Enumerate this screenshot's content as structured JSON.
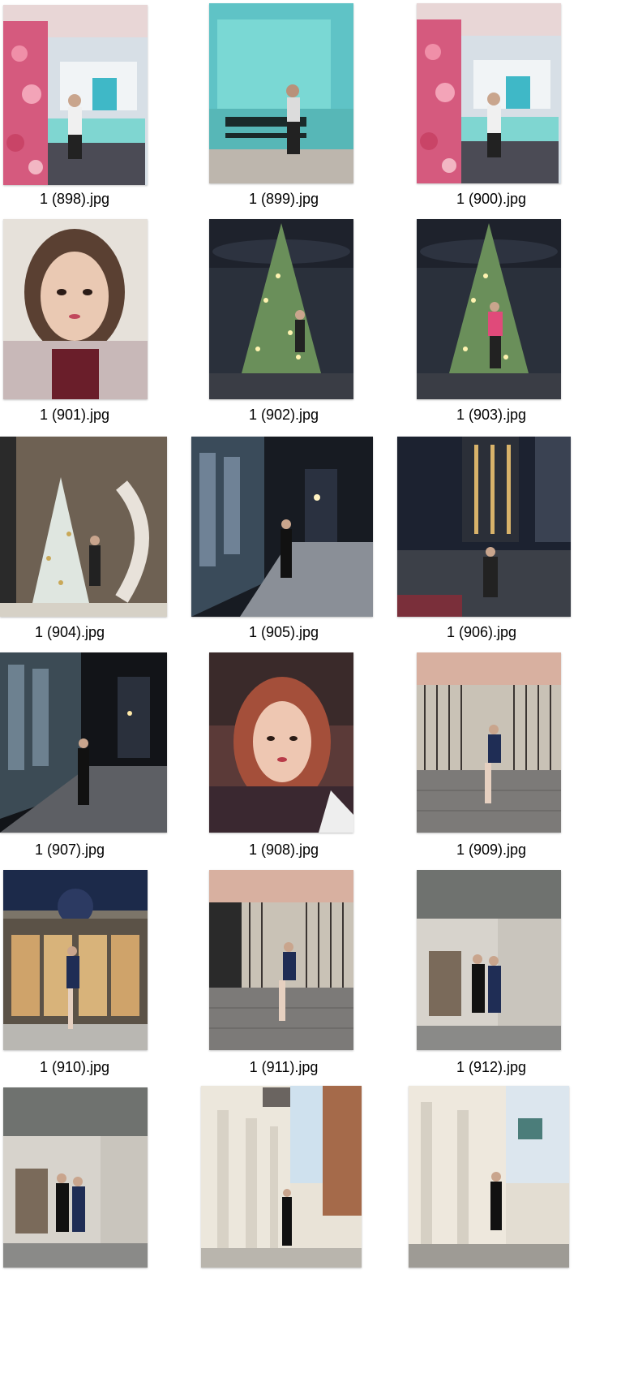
{
  "files": [
    {
      "name": "1 (898).jpg",
      "image": "tiffany-rose-booth-photo"
    },
    {
      "name": "1 (899).jpg",
      "image": "tiffany-blue-bench-photo"
    },
    {
      "name": "1 (900).jpg",
      "image": "tiffany-rose-booth-photo"
    },
    {
      "name": "1 (901).jpg",
      "image": "selfie-tweed-jacket-photo"
    },
    {
      "name": "1 (902).jpg",
      "image": "christmas-tree-lobby-photo"
    },
    {
      "name": "1 (903).jpg",
      "image": "christmas-tree-lobby-photo"
    },
    {
      "name": "1 (904).jpg",
      "image": "christmas-tree-staircase-photo"
    },
    {
      "name": "1 (905).jpg",
      "image": "night-street-photo"
    },
    {
      "name": "1 (906).jpg",
      "image": "night-street-photo"
    },
    {
      "name": "1 (907).jpg",
      "image": "night-street-photo"
    },
    {
      "name": "1 (908).jpg",
      "image": "car-selfie-photo"
    },
    {
      "name": "1 (909).jpg",
      "image": "iron-gate-steps-photo"
    },
    {
      "name": "1 (910).jpg",
      "image": "building-entrance-photo"
    },
    {
      "name": "1 (911).jpg",
      "image": "iron-gate-steps-photo"
    },
    {
      "name": "1 (912).jpg",
      "image": "building-corner-photo"
    },
    {
      "name": "",
      "image": "building-corner-photo"
    },
    {
      "name": "",
      "image": "herno-street-photo"
    },
    {
      "name": "",
      "image": "street-storefront-photo"
    }
  ],
  "colors": {
    "tiffany": "#7fd6d1",
    "rose": "#e06a86",
    "night": "#1c2230",
    "street": "#8a8f97",
    "skin": "#e8c3a8",
    "tree": "#6a8f5a"
  }
}
